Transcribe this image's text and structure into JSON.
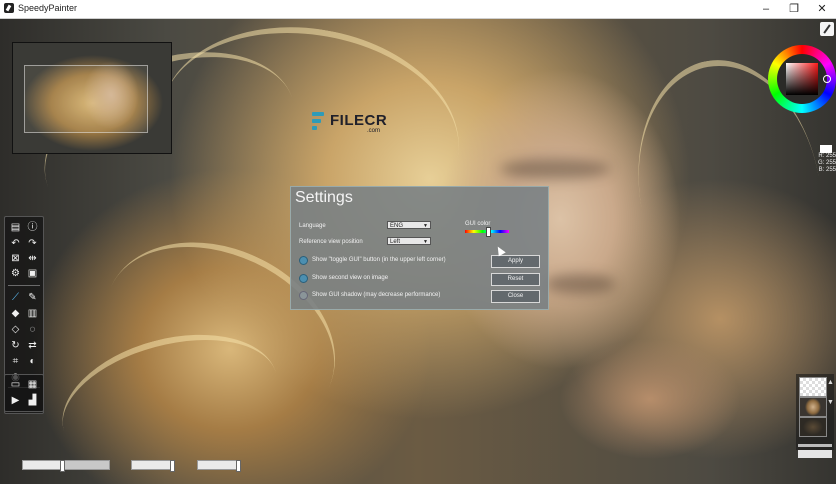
{
  "window": {
    "title": "SpeedyPainter",
    "controls": {
      "minimize": "–",
      "maximize": "❐",
      "close": "✕"
    }
  },
  "watermark": {
    "brand": "FILECR",
    "sub": ".com"
  },
  "settings": {
    "title": "Settings",
    "language": {
      "label": "Language",
      "value": "ENG"
    },
    "reference_position": {
      "label": "Reference view position",
      "value": "Left"
    },
    "gui_color": {
      "label": "GUI color"
    },
    "options": [
      {
        "label": "Show \"toggle GUI\" button (in the upper left corner)",
        "checked": true
      },
      {
        "label": "Show second view on image",
        "checked": true
      },
      {
        "label": "Show GUI shadow (may decrease performance)",
        "checked": false
      }
    ],
    "buttons": {
      "apply": "Apply",
      "reset": "Reset",
      "close": "Close"
    }
  },
  "color_readout": {
    "r": "R: 255",
    "g": "G: 255",
    "b": "B: 255"
  },
  "toolbar": {
    "icons": [
      "new-file-icon",
      "info-icon",
      "undo-icon",
      "redo-icon",
      "resize-icon",
      "flip-icon",
      "settings-gear-icon",
      "image-size-icon",
      "brush-icon",
      "pencil-icon",
      "fill-bucket-icon",
      "gradient-icon",
      "eraser-icon",
      "blur-icon",
      "rotate-icon",
      "mirror-icon",
      "crop-icon",
      "contrast-icon",
      "color-picker-icon",
      "open-folder-icon",
      "save-icon",
      "play-icon",
      "export-icon"
    ]
  }
}
